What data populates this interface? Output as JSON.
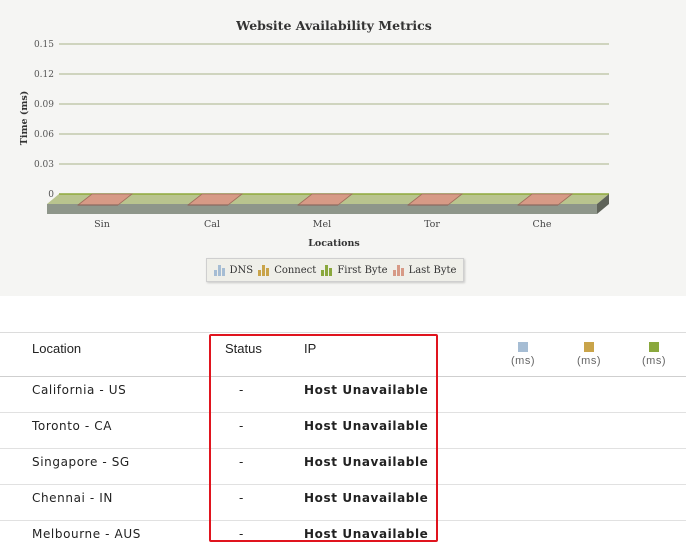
{
  "chart_data": {
    "type": "bar",
    "title": "Website Availability Metrics",
    "xlabel": "Locations",
    "ylabel": "Time (ms)",
    "categories": [
      "Sin",
      "Cal",
      "Mel",
      "Tor",
      "Che"
    ],
    "yticks": [
      "0.15",
      "0.12",
      "0.09",
      "0.06",
      "0.03",
      "0"
    ],
    "ylim": [
      0,
      0.15
    ],
    "stacked": true,
    "grid": true,
    "legend_position": "bottom",
    "series": [
      {
        "name": "DNS",
        "values": [
          0,
          0,
          0,
          0,
          0
        ],
        "color": "#a6bdd4"
      },
      {
        "name": "Connect",
        "values": [
          0,
          0,
          0,
          0,
          0
        ],
        "color": "#c9a44a"
      },
      {
        "name": "First Byte",
        "values": [
          0,
          0,
          0,
          0,
          0
        ],
        "color": "#8aa83d"
      },
      {
        "name": "Last Byte",
        "values": [
          0,
          0,
          0,
          0,
          0
        ],
        "color": "#d79a86"
      }
    ]
  },
  "legend": {
    "items": [
      {
        "label": "DNS",
        "color": "#a6bdd4"
      },
      {
        "label": "Connect",
        "color": "#c9a44a"
      },
      {
        "label": "First Byte",
        "color": "#8aa83d"
      },
      {
        "label": "Last Byte",
        "color": "#d79a86"
      }
    ]
  },
  "table": {
    "headers": {
      "location": "Location",
      "status": "Status",
      "ip": "IP"
    },
    "metric_columns": [
      {
        "unit": "(ms)",
        "color": "#a6bdd4"
      },
      {
        "unit": "(ms)",
        "color": "#c9a44a"
      },
      {
        "unit": "(ms)",
        "color": "#8aa83d"
      }
    ],
    "rows": [
      {
        "location": "California - US",
        "status": "-",
        "ip": "Host Unavailable"
      },
      {
        "location": "Toronto - CA",
        "status": "-",
        "ip": "Host Unavailable"
      },
      {
        "location": "Singapore - SG",
        "status": "-",
        "ip": "Host Unavailable"
      },
      {
        "location": "Chennai - IN",
        "status": "-",
        "ip": "Host Unavailable"
      },
      {
        "location": "Melbourne - AUS",
        "status": "-",
        "ip": "Host Unavailable"
      }
    ]
  },
  "highlight_color": "#e0141e"
}
